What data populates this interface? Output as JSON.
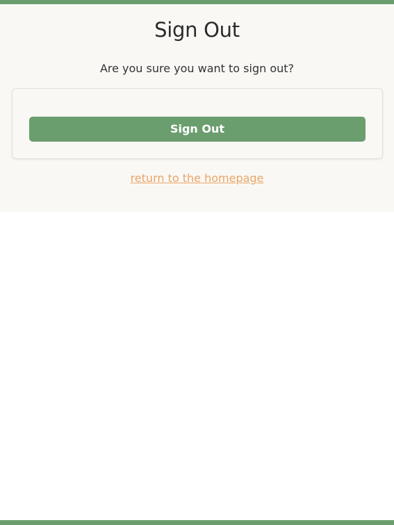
{
  "page": {
    "title": "Sign Out",
    "confirm_message": "Are you sure you want to sign out?"
  },
  "form": {
    "submit_label": "Sign Out"
  },
  "links": {
    "home_label": "return to the homepage"
  },
  "colors": {
    "accent": "#6b9e6e",
    "section_background": "#f9f8f5",
    "card_background": "#f9f8f5",
    "link": "#eba566"
  }
}
